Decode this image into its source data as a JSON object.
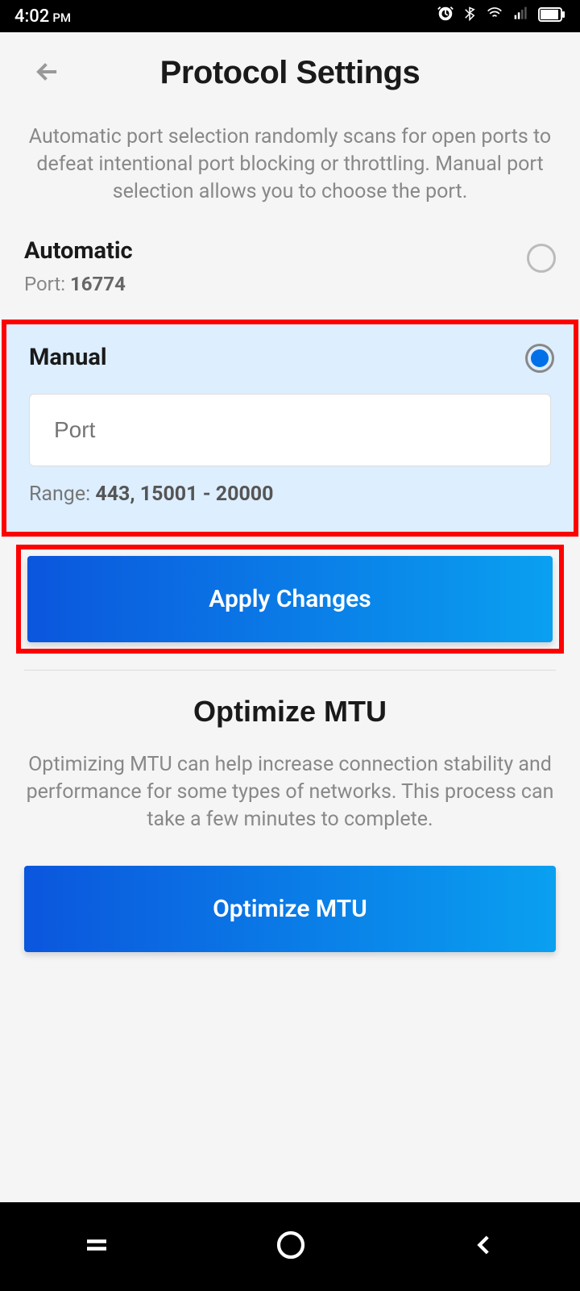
{
  "statusBar": {
    "time": "4:02",
    "ampm": "PM"
  },
  "header": {
    "title": "Protocol Settings"
  },
  "intro": {
    "description": "Automatic port selection randomly scans for open ports to defeat intentional port blocking or throttling. Manual port selection allows you to choose the port."
  },
  "automatic": {
    "title": "Automatic",
    "portLabel": "Port: ",
    "portValue": "16774",
    "selected": false
  },
  "manual": {
    "title": "Manual",
    "inputPlaceholder": "Port",
    "inputValue": "",
    "rangeLabel": "Range:  ",
    "rangeValue": "443, 15001 - 20000",
    "selected": true
  },
  "buttons": {
    "applyChanges": "Apply Changes",
    "optimizeMtu": "Optimize MTU"
  },
  "mtu": {
    "title": "Optimize MTU",
    "description": "Optimizing MTU can help increase connection stability and performance for some types of networks. This process can take a few minutes to complete."
  }
}
